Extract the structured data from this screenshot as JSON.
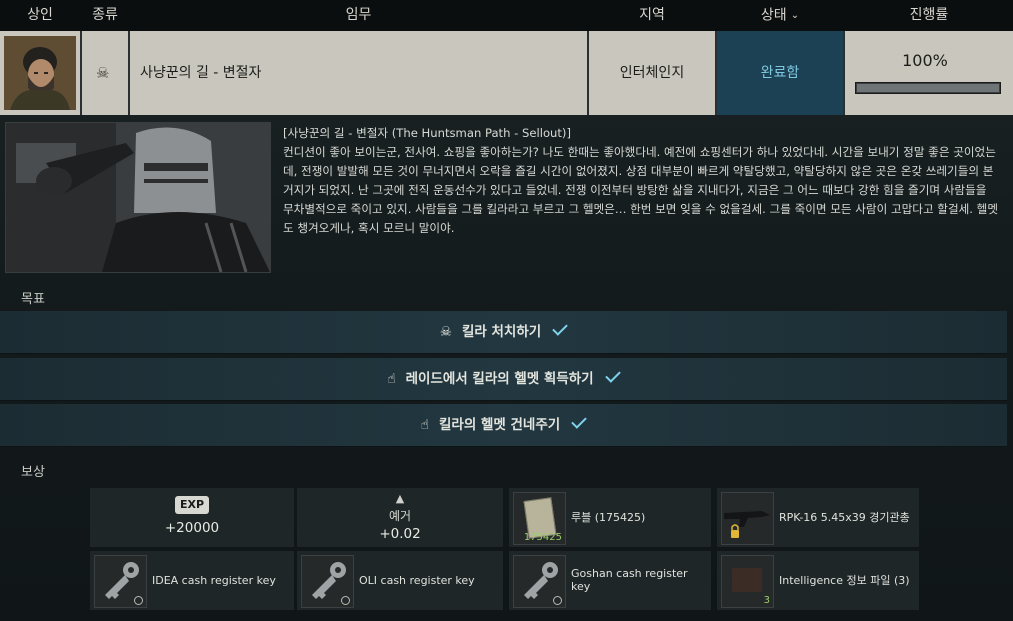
{
  "header": {
    "trader": "상인",
    "type": "종류",
    "quest": "임무",
    "location": "지역",
    "status": "상태",
    "progress": "진행률"
  },
  "quest_row": {
    "name": "사냥꾼의 길 - 변절자",
    "location": "인터체인지",
    "status": "완료함",
    "progress_text": "100%",
    "progress_value": 1.0,
    "type_icon": "skull-icon"
  },
  "description": {
    "title": "[사냥꾼의 길 - 변절자 (The Huntsman Path - Sellout)]",
    "body": "컨디션이 좋아 보이는군, 전사여. 쇼핑을 좋아하는가? 나도 한때는 좋아했다네. 예전에 쇼핑센터가 하나 있었다네. 시간을 보내기 정말 좋은 곳이었는데, 전쟁이 발발해 모든 것이 무너지면서 오락을 즐길 시간이 없어졌지. 상점 대부분이 빠르게 약탈당했고, 약탈당하지 않은 곳은 온갖 쓰레기들의 본거지가 되었지. 난 그곳에 전직 운동선수가 있다고 들었네. 전쟁 이전부터 방탕한 삶을 지내다가, 지금은 그 어느 때보다 강한 힘을 즐기며 사람들을 무차별적으로 죽이고 있지. 사람들을 그를 킬라라고 부르고 그 헬멧은… 한번 보면 잊을 수 없을걸세. 그를 죽이면 모든 사람이 고맙다고 할걸세. 헬멧도 챙겨오게나, 혹시 모르니 말이야."
  },
  "objectives_label": "목표",
  "objectives": [
    {
      "label": "킬라 처치하기",
      "icon": "skull-icon",
      "done": true
    },
    {
      "label": "레이드에서 킬라의 헬멧 획득하기",
      "icon": "hand-pointer-icon",
      "done": true
    },
    {
      "label": "킬라의 헬멧 건네주기",
      "icon": "hand-pointer-icon",
      "done": true
    }
  ],
  "rewards_label": "보상",
  "rewards": {
    "exp": {
      "badge": "EXP",
      "value": "+20000"
    },
    "standing": {
      "label": "예거",
      "value": "+0.02"
    },
    "items": [
      {
        "label": "루블 (175425)",
        "count": "175425",
        "icon": "roubles-icon"
      },
      {
        "label": "RPK-16 5.45x39 경기관총",
        "icon": "rifle-icon",
        "locked": true
      },
      {
        "label": "IDEA cash register key",
        "icon": "key-icon"
      },
      {
        "label": "OLI cash register key",
        "icon": "key-icon"
      },
      {
        "label": "Goshan cash register key",
        "icon": "key-icon"
      },
      {
        "label": "Intelligence 정보 파일 (3)",
        "count": "3",
        "icon": "folder-icon"
      }
    ]
  },
  "colors": {
    "status_bg": "#1d4154",
    "status_text": "#7fc8e0",
    "check": "#7ed2ec",
    "cell_bg": "#c9c7bd"
  }
}
